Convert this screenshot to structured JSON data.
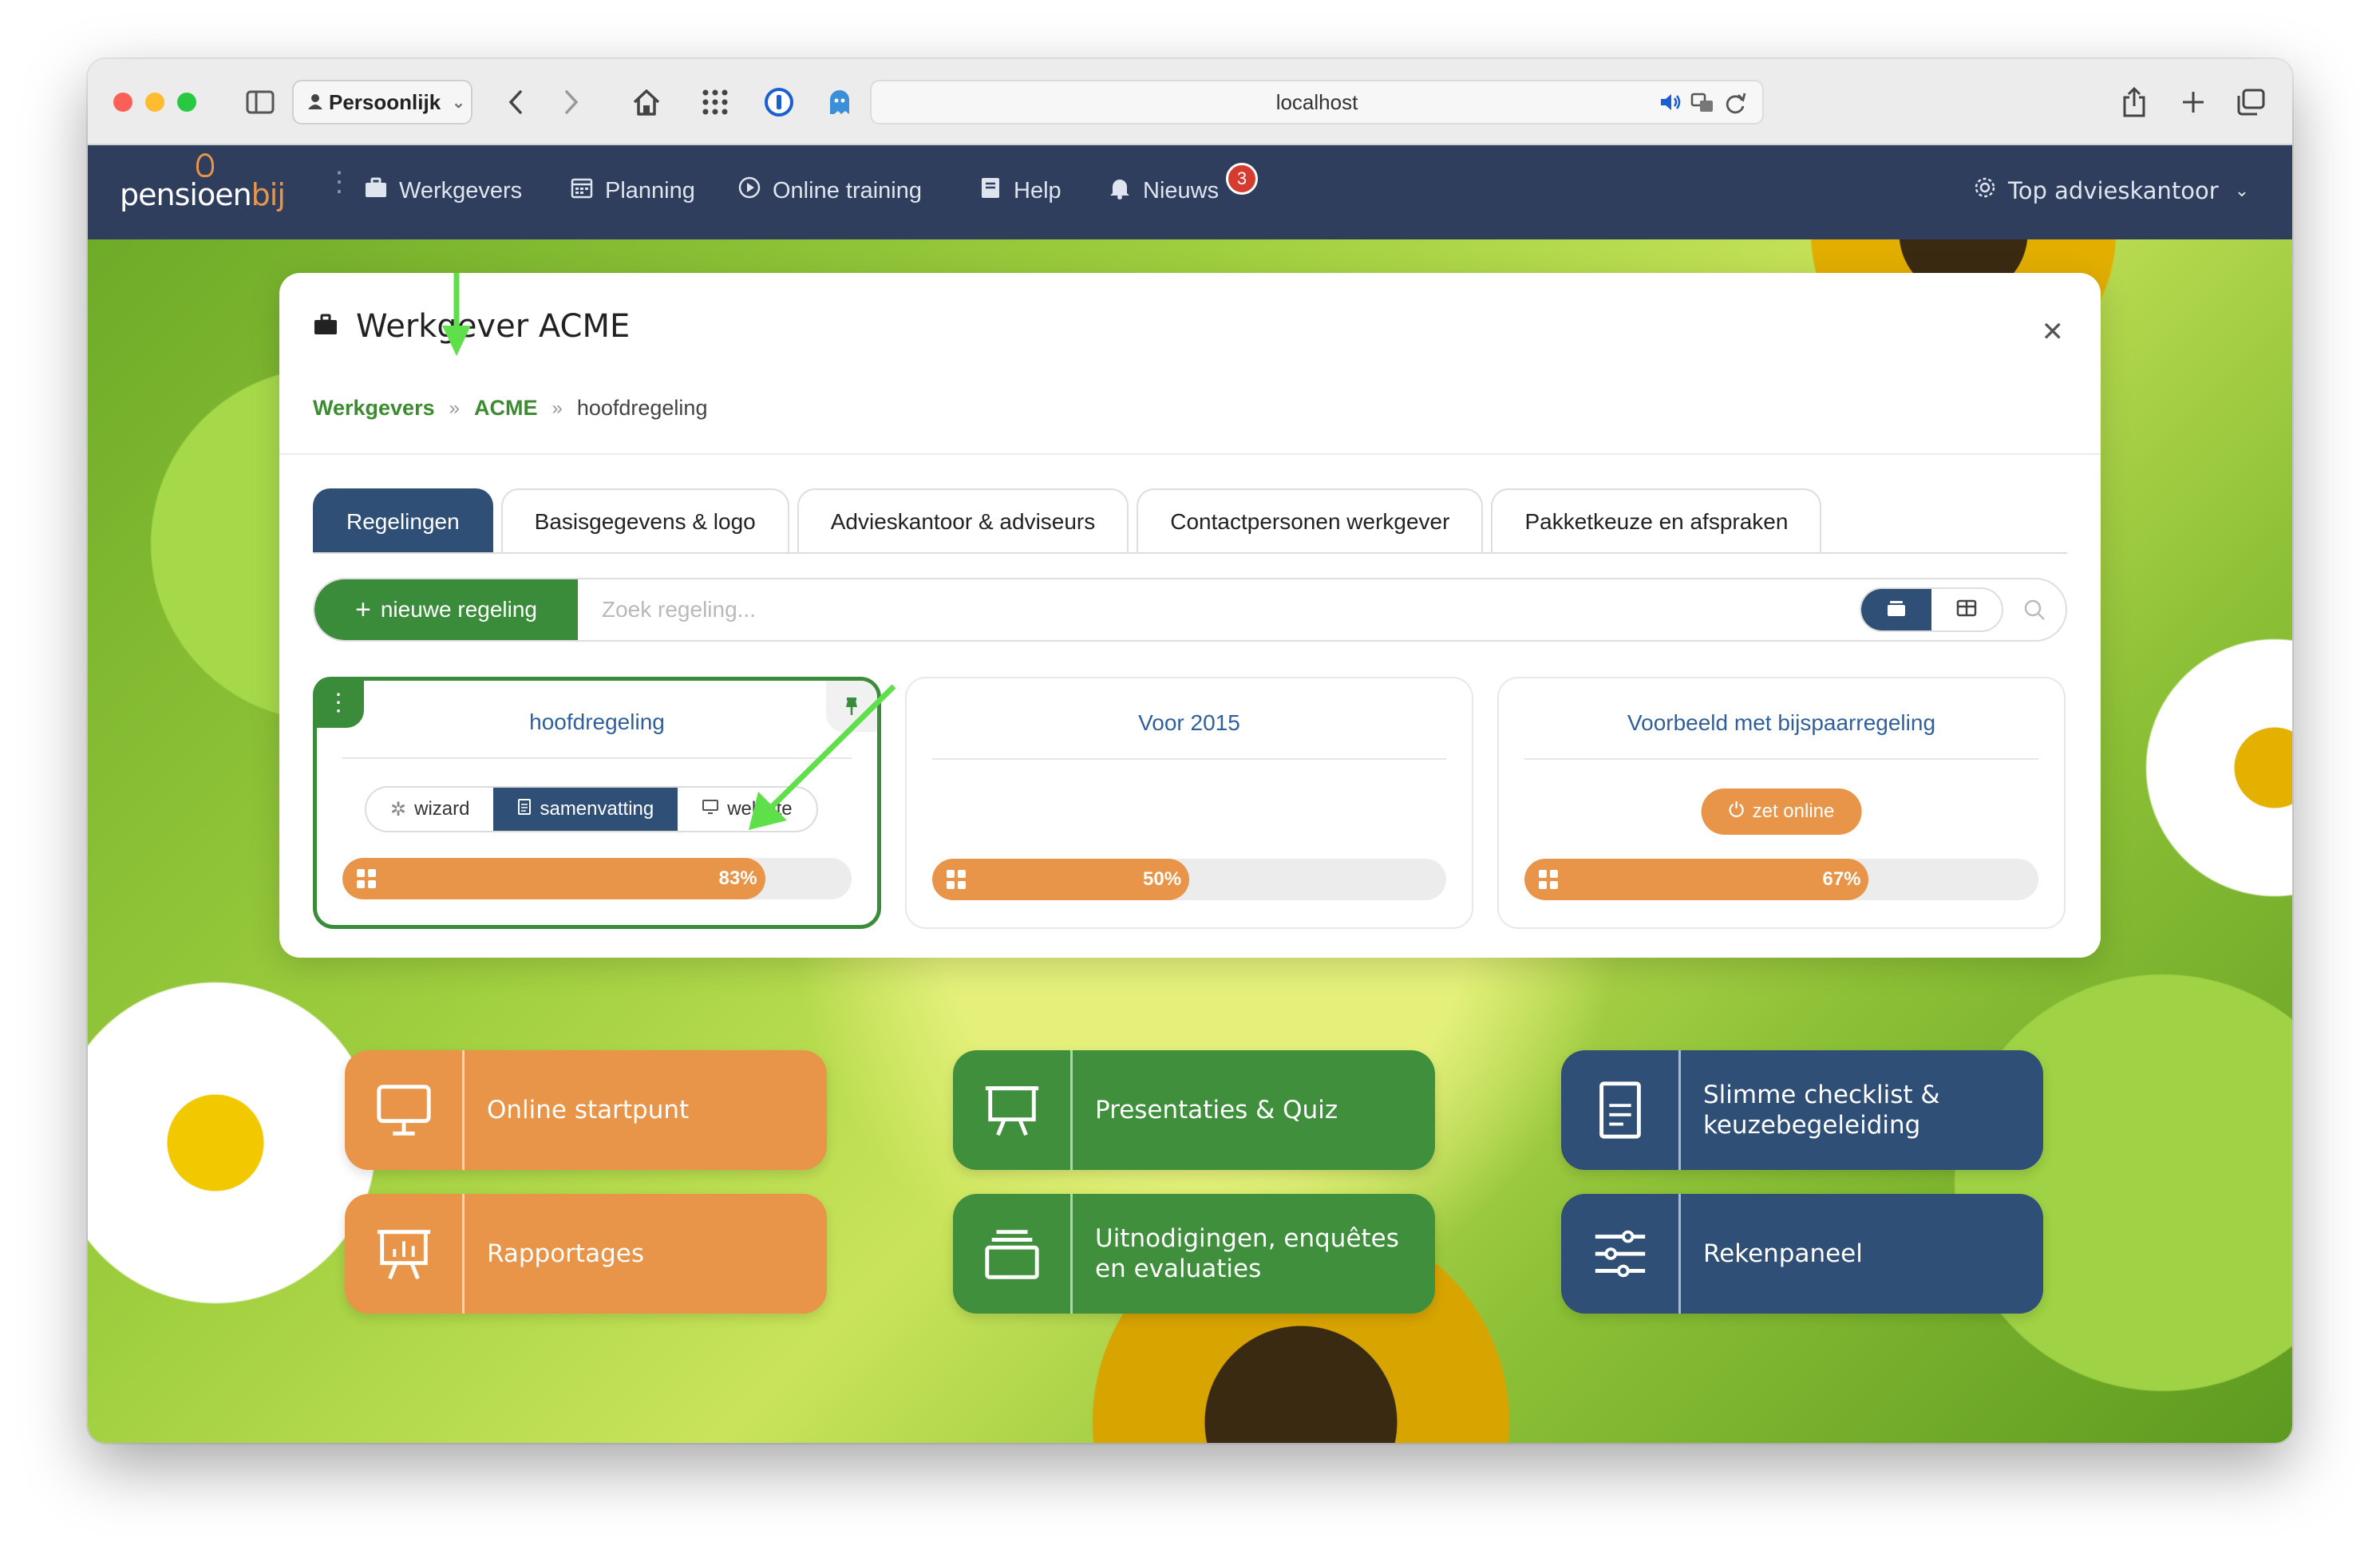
{
  "browser": {
    "profile": "Persoonlijk",
    "url": "localhost"
  },
  "nav": {
    "logo_main": "pensioen",
    "logo_accent": "bij",
    "items": [
      {
        "label": "Werkgevers",
        "icon": "briefcase-icon"
      },
      {
        "label": "Planning",
        "icon": "calendar-icon"
      },
      {
        "label": "Online training",
        "icon": "play-circle-icon"
      },
      {
        "label": "Help",
        "icon": "book-icon"
      },
      {
        "label": "Nieuws",
        "icon": "bell-icon"
      }
    ],
    "news_badge": "3",
    "office": "Top advieskantoor"
  },
  "modal": {
    "title": "Werkgever ACME",
    "breadcrumb": [
      "Werkgevers",
      "ACME",
      "hoofdregeling"
    ],
    "tabs": [
      "Regelingen",
      "Basisgegevens & logo",
      "Advieskantoor & adviseurs",
      "Contactpersonen werkgever",
      "Pakketkeuze en afspraken"
    ],
    "new_button": "nieuwe regeling",
    "search_placeholder": "Zoek regeling...",
    "cards": [
      {
        "title": "hoofdregeling",
        "progress": 83,
        "progress_label": "83%",
        "actions": [
          "wizard",
          "samenvatting",
          "website"
        ]
      },
      {
        "title": "Voor 2015",
        "progress": 50,
        "progress_label": "50%"
      },
      {
        "title": "Voorbeeld met bijspaarregeling",
        "progress": 67,
        "progress_label": "67%",
        "button": "zet online"
      }
    ]
  },
  "tiles": [
    {
      "label": "Online startpunt",
      "icon": "monitor-icon",
      "color": "#e8954a"
    },
    {
      "label": "Presentaties & Quiz",
      "icon": "presentation-icon",
      "color": "#3f8f3d"
    },
    {
      "label": "Slimme checklist &\nkeuzebegeleiding",
      "icon": "document-icon",
      "color": "#2f4f76"
    },
    {
      "label": "Rapportages",
      "icon": "chart-board-icon",
      "color": "#e8954a"
    },
    {
      "label": "Uitnodigingen, enquêtes\nen evaluaties",
      "icon": "stack-icon",
      "color": "#3f8f3d"
    },
    {
      "label": "Rekenpaneel",
      "icon": "sliders-icon",
      "color": "#2f4f76"
    }
  ],
  "colors": {
    "nav_bg": "#2f3e5c",
    "accent_green": "#3a8c3a",
    "accent_orange": "#e8954a",
    "accent_navy": "#2f4f76",
    "arrow": "#5fe04a"
  }
}
